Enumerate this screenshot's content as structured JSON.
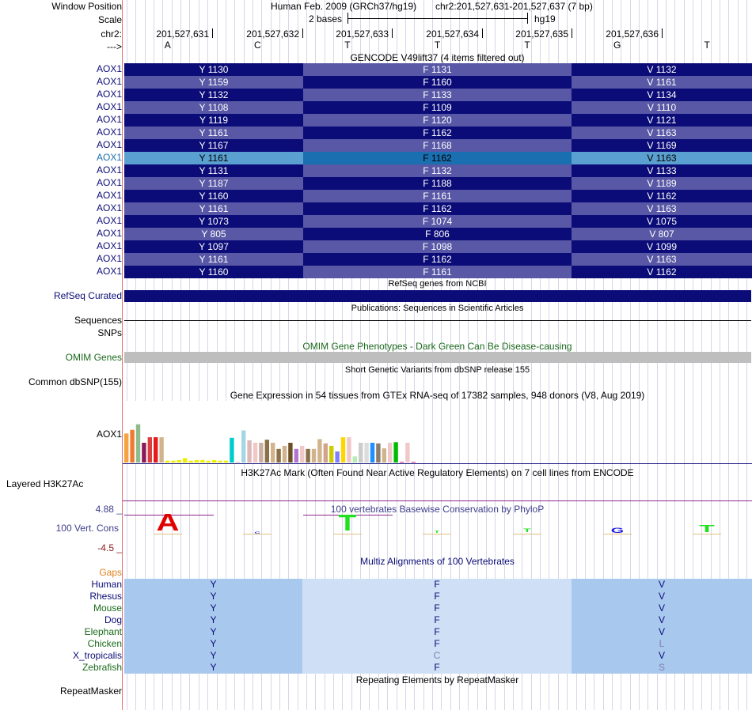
{
  "header": {
    "window_position_label": "Window Position",
    "scale_label": "Scale",
    "chrom_label": "chr2:",
    "strand_label": "--->",
    "assembly_text": "Human Feb. 2009 (GRCh37/hg19)",
    "position_text": "chr2:201,527,631-201,527,637 (7 bp)",
    "scale_text": "2 bases",
    "db_text": "hg19",
    "ruler_positions": [
      "201,527,631",
      "201,527,632",
      "201,527,633",
      "201,527,634",
      "201,527,635",
      "201,527,636"
    ],
    "bases": [
      "A",
      "C",
      "T",
      "T",
      "T",
      "G",
      "T"
    ]
  },
  "gencode": {
    "title": "GENCODE V49lift37 (4 items filtered out)",
    "colors": {
      "dark": "#0c0c78",
      "medium": "#5858a6",
      "selected_dark": "#1a6fb0",
      "selected_light": "#5aa0d0"
    },
    "rows": [
      {
        "label": "AOX1",
        "c1": "Y 1130",
        "c2": "F 1131",
        "c3": "V 1132"
      },
      {
        "label": "AOX1",
        "c1": "Y 1159",
        "c2": "F 1160",
        "c3": "V 1161"
      },
      {
        "label": "AOX1",
        "c1": "Y 1132",
        "c2": "F 1133",
        "c3": "V 1134"
      },
      {
        "label": "AOX1",
        "c1": "Y 1108",
        "c2": "F 1109",
        "c3": "V 1110"
      },
      {
        "label": "AOX1",
        "c1": "Y 1119",
        "c2": "F 1120",
        "c3": "V 1121"
      },
      {
        "label": "AOX1",
        "c1": "Y 1161",
        "c2": "F 1162",
        "c3": "V 1163"
      },
      {
        "label": "AOX1",
        "c1": "Y 1167",
        "c2": "F 1168",
        "c3": "V 1169"
      },
      {
        "label": "AOX1",
        "c1": "Y 1161",
        "c2": "F 1162",
        "c3": "V 1163",
        "selected": true
      },
      {
        "label": "AOX1",
        "c1": "Y 1131",
        "c2": "F 1132",
        "c3": "V 1133"
      },
      {
        "label": "AOX1",
        "c1": "Y 1187",
        "c2": "F 1188",
        "c3": "V 1189"
      },
      {
        "label": "AOX1",
        "c1": "Y 1160",
        "c2": "F 1161",
        "c3": "V 1162"
      },
      {
        "label": "AOX1",
        "c1": "Y 1161",
        "c2": "F 1162",
        "c3": "V 1163"
      },
      {
        "label": "AOX1",
        "c1": "Y 1073",
        "c2": "F 1074",
        "c3": "V 1075"
      },
      {
        "label": "AOX1",
        "c1": "Y 805",
        "c2": "F 806",
        "c3": "V 807"
      },
      {
        "label": "AOX1",
        "c1": "Y 1097",
        "c2": "F 1098",
        "c3": "V 1099"
      },
      {
        "label": "AOX1",
        "c1": "Y 1161",
        "c2": "F 1162",
        "c3": "V 1163"
      },
      {
        "label": "AOX1",
        "c1": "Y 1160",
        "c2": "F 1161",
        "c3": "V 1162"
      }
    ]
  },
  "refseq": {
    "title": "RefSeq genes from NCBI",
    "label": "RefSeq Curated"
  },
  "publications": {
    "title": "Publications: Sequences in Scientific Articles",
    "label_sequences": "Sequences",
    "label_snps": "SNPs"
  },
  "omim": {
    "title": "OMIM Gene Phenotypes - Dark Green Can Be Disease-causing",
    "label": "OMIM Genes"
  },
  "dbsnp": {
    "title": "Short Genetic Variants from dbSNP release 155",
    "label": "Common dbSNP(155)"
  },
  "gtex": {
    "title": "Gene Expression in 54 tissues from GTEx RNA-seq of 17382 samples, 948 donors (V8, Aug 2019)",
    "label": "AOX1",
    "bars": [
      {
        "c": "#f4a340",
        "v": 0.47
      },
      {
        "c": "#f07b30",
        "v": 0.53
      },
      {
        "c": "#8fbc8f",
        "v": 0.62
      },
      {
        "c": "#8b1a5a",
        "v": 0.32
      },
      {
        "c": "#d94040",
        "v": 0.41
      },
      {
        "c": "#e41a1c",
        "v": 0.41
      },
      {
        "c": "#d2b48c",
        "v": 0.41
      },
      {
        "c": "#eeee00",
        "v": 0.03
      },
      {
        "c": "#eeee00",
        "v": 0.03
      },
      {
        "c": "#eeee00",
        "v": 0.04
      },
      {
        "c": "#eeee00",
        "v": 0.07
      },
      {
        "c": "#eeee00",
        "v": 0.03
      },
      {
        "c": "#eeee00",
        "v": 0.04
      },
      {
        "c": "#eeee00",
        "v": 0.04
      },
      {
        "c": "#eeee00",
        "v": 0.03
      },
      {
        "c": "#eeee00",
        "v": 0.04
      },
      {
        "c": "#eeee00",
        "v": 0.03
      },
      {
        "c": "#eeee00",
        "v": 0.03
      },
      {
        "c": "#00cccc",
        "v": 0.4
      },
      {
        "c": "#cccccc",
        "v": 0.01
      },
      {
        "c": "#a4d7e3",
        "v": 0.52
      },
      {
        "c": "#dcb8b8",
        "v": 0.36
      },
      {
        "c": "#f0c8c8",
        "v": 0.32
      },
      {
        "c": "#cbb0a0",
        "v": 0.32
      },
      {
        "c": "#8b6f47",
        "v": 0.37
      },
      {
        "c": "#d2b48c",
        "v": 0.32
      },
      {
        "c": "#8b6f47",
        "v": 0.22
      },
      {
        "c": "#d2b48c",
        "v": 0.27
      },
      {
        "c": "#6b4f27",
        "v": 0.32
      },
      {
        "c": "#b276d0",
        "v": 0.22
      },
      {
        "c": "#f0c8c8",
        "v": 0.27
      },
      {
        "c": "#8b6f47",
        "v": 0.22
      },
      {
        "c": "#d2b48c",
        "v": 0.22
      },
      {
        "c": "#d2b48c",
        "v": 0.38
      },
      {
        "c": "#d2a48c",
        "v": 0.31
      },
      {
        "c": "#cccc00",
        "v": 0.27
      },
      {
        "c": "#7f7fff",
        "v": 0.18
      },
      {
        "c": "#ffd700",
        "v": 0.41
      },
      {
        "c": "#f0c8c8",
        "v": 0.41
      },
      {
        "c": "#b4eeb4",
        "v": 0.1
      },
      {
        "c": "#cccccc",
        "v": 0.32
      },
      {
        "c": "#dcdcdc",
        "v": 0.32
      },
      {
        "c": "#1e90ff",
        "v": 0.32
      },
      {
        "c": "#8b7d6b",
        "v": 0.31
      },
      {
        "c": "#d2b48c",
        "v": 0.23
      },
      {
        "c": "#f0c8c8",
        "v": 0.32
      },
      {
        "c": "#00bb00",
        "v": 0.33
      },
      {
        "c": "#cc3399",
        "v": 0.0
      },
      {
        "c": "#f0c8c8",
        "v": 0.32
      },
      {
        "c": "#cc3399",
        "v": 0.01
      }
    ]
  },
  "h3k27ac": {
    "title": "H3K27Ac Mark (Often Found Near Active Regulatory Elements) on 7 cell lines from ENCODE",
    "label": "Layered H3K27Ac"
  },
  "phylop": {
    "title": "100 vertebrates Basewise Conservation by PhyloP",
    "label": "100 Vert. Cons",
    "max_label": "4.88 _",
    "min_label": "-4.5 _",
    "letters": [
      "A",
      "C",
      "T",
      "T",
      "T",
      "G",
      "T"
    ]
  },
  "multiz": {
    "title": "Multiz Alignments of 100 Vertebrates",
    "gaps_label": "Gaps",
    "rows": [
      {
        "species": "Human",
        "a": "Y",
        "b": "F",
        "c": "V"
      },
      {
        "species": "Rhesus",
        "a": "Y",
        "b": "F",
        "c": "V"
      },
      {
        "species": "Mouse",
        "a": "Y",
        "b": "F",
        "c": "V"
      },
      {
        "species": "Dog",
        "a": "Y",
        "b": "F",
        "c": "V"
      },
      {
        "species": "Elephant",
        "a": "Y",
        "b": "F",
        "c": "V"
      },
      {
        "species": "Chicken",
        "a": "Y",
        "b": "F",
        "c": "L"
      },
      {
        "species": "X_tropicalis",
        "a": "Y",
        "b": "C",
        "c": "V"
      },
      {
        "species": "Zebrafish",
        "a": "Y",
        "b": "F",
        "c": "S"
      }
    ]
  },
  "repeatmasker": {
    "title": "Repeating Elements by RepeatMasker",
    "label": "RepeatMasker"
  }
}
